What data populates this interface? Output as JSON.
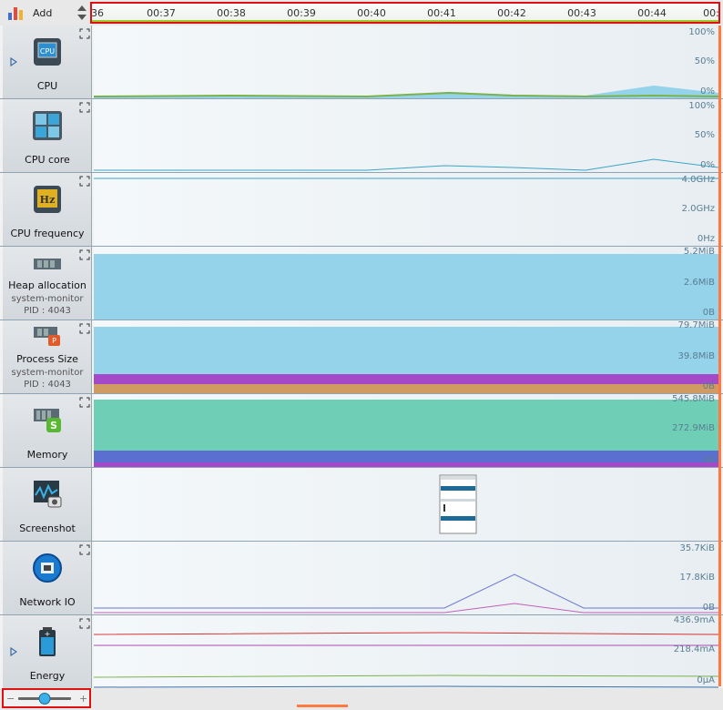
{
  "toolbar": {
    "add_label": "Add"
  },
  "timeline": {
    "ticks": [
      "36",
      "00:37",
      "00:38",
      "00:39",
      "00:40",
      "00:41",
      "00:42",
      "00:43",
      "00:44",
      "00:"
    ]
  },
  "rows": [
    {
      "label": "CPU",
      "icon": "cpu-icon",
      "axis": [
        "100%",
        "50%",
        "0%"
      ]
    },
    {
      "label": "CPU core",
      "icon": "cpu-core-icon",
      "axis": [
        "100%",
        "50%",
        "0%"
      ]
    },
    {
      "label": "CPU frequency",
      "icon": "cpu-frequency-icon",
      "axis": [
        "4.0GHz",
        "2.0GHz",
        "0Hz"
      ]
    },
    {
      "label": "Heap allocation",
      "sub1": "system-monitor",
      "sub2": "PID : 4043",
      "icon": "heap-allocation-icon",
      "axis": [
        "5.2MiB",
        "2.6MiB",
        "0B"
      ]
    },
    {
      "label": "Process Size",
      "sub1": "system-monitor",
      "sub2": "PID : 4043",
      "icon": "process-size-icon",
      "axis": [
        "79.7MiB",
        "39.8MiB",
        "0B"
      ]
    },
    {
      "label": "Memory",
      "icon": "memory-icon",
      "axis": [
        "545.8MiB",
        "272.9MiB",
        "0B"
      ]
    },
    {
      "label": "Screenshot",
      "icon": "screenshot-icon",
      "axis": []
    },
    {
      "label": "Network IO",
      "icon": "network-io-icon",
      "axis": [
        "35.7KiB",
        "17.8KiB",
        "0B"
      ]
    },
    {
      "label": "Energy",
      "icon": "energy-icon",
      "axis": [
        "436.9mA",
        "218.4mA",
        "0μA"
      ]
    }
  ],
  "colors": {
    "cursor": "#ff7a40",
    "highlight": "#e01010",
    "fill_blue": "#94d3ea",
    "memory_green": "#6fcfb6",
    "memory_blue": "#5b6fd0",
    "purple": "#a349c9"
  },
  "zoom": {
    "level": 0.5
  }
}
